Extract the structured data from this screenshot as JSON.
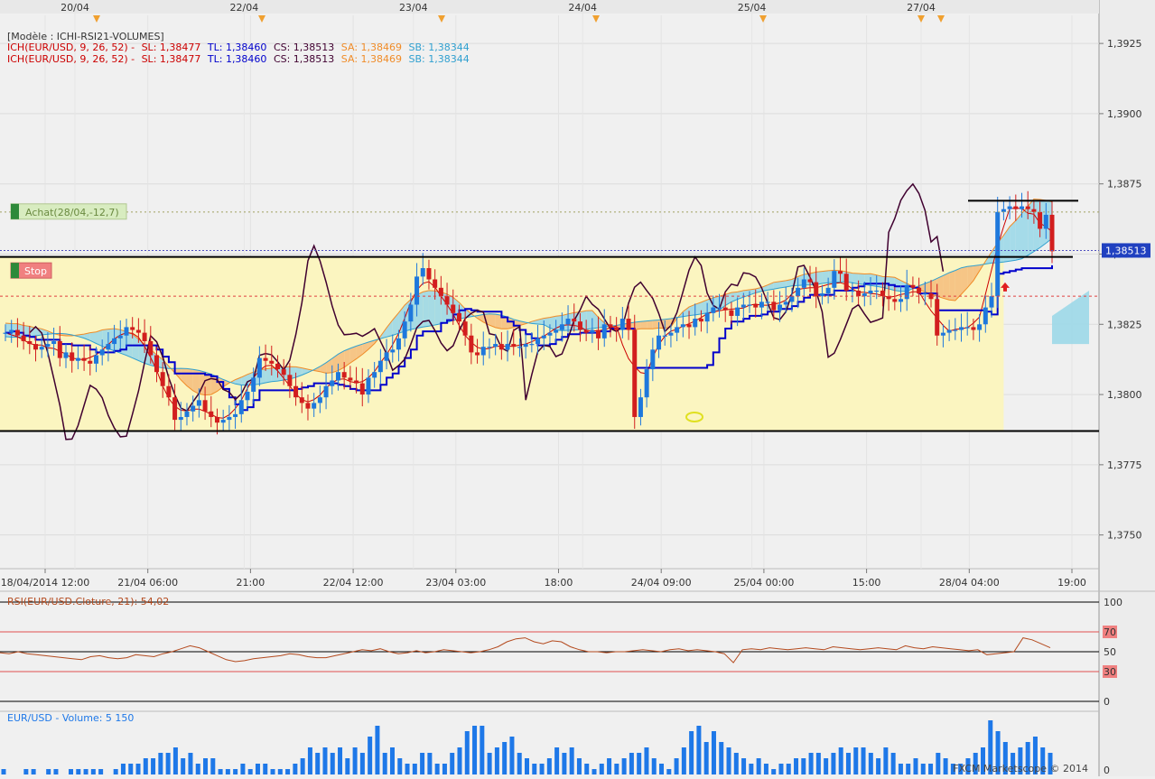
{
  "header": {
    "model_label": "[Modèle : ICHI-RSI21-VOLUMES]",
    "ich_lines": [
      {
        "prefix": "ICH(EUR/USD, 9, 26, 52) -",
        "sl": "SL: 1,38477",
        "tl": "TL: 1,38460",
        "cs": "CS: 1,38513",
        "sa": "SA: 1,38469",
        "sb": "SB: 1,38344"
      },
      {
        "prefix": "ICH(EUR/USD, 9, 26, 52) -",
        "sl": "SL: 1,38477",
        "tl": "TL: 1,38460",
        "cs": "CS: 1,38513",
        "sa": "SA: 1,38469",
        "sb": "SB: 1,38344"
      }
    ]
  },
  "colors": {
    "sl": "#cc0000",
    "tl": "#0000cc",
    "cs": "#400030",
    "sa": "#f08c28",
    "sb": "#30a0d0",
    "up_candle": "#1e78dc",
    "down_candle": "#d21e1e",
    "range_box": "#fbf5c0",
    "cloud_bear": "#f5c080",
    "cloud_bull": "#9cd8e8",
    "volume": "#1e78e8",
    "rsi": "#b44a1e"
  },
  "top_dates": [
    "20/04",
    "22/04",
    "23/04",
    "24/04",
    "25/04",
    "27/04"
  ],
  "annotations": {
    "buy_label": "Achat(28/04,-12,7)",
    "stop_label": "Stop",
    "last_price": "1,38513"
  },
  "watermark": "FXCM Marketscope © 2014",
  "chart_data": [
    {
      "type": "candlestick",
      "title": "EUR/USD",
      "x_tick_labels": [
        "18/04/2014 12:00",
        "21/04 06:00",
        "21:00",
        "22/04 12:00",
        "23/04 03:00",
        "18:00",
        "24/04 09:00",
        "25/04 00:00",
        "15:00",
        "28/04 04:00",
        "19:00"
      ],
      "y_tick_labels": [
        "1,3925",
        "1,3900",
        "1,3875",
        "1,3850",
        "1,3825",
        "1,3800",
        "1,3775",
        "1,3750"
      ],
      "ylim": [
        1.3738,
        1.3935
      ],
      "close": [
        1.3822,
        1.3823,
        1.3821,
        1.3819,
        1.3818,
        1.3816,
        1.3817,
        1.3818,
        1.3819,
        1.3813,
        1.3815,
        1.3812,
        1.3813,
        1.3812,
        1.3811,
        1.3814,
        1.3816,
        1.3818,
        1.382,
        1.3821,
        1.3824,
        1.3823,
        1.3822,
        1.3819,
        1.3814,
        1.3808,
        1.3803,
        1.3799,
        1.3791,
        1.3792,
        1.3794,
        1.3796,
        1.3798,
        1.3794,
        1.3792,
        1.379,
        1.3791,
        1.3792,
        1.3793,
        1.3798,
        1.3801,
        1.3806,
        1.3813,
        1.3812,
        1.3811,
        1.3809,
        1.3807,
        1.3803,
        1.3799,
        1.3797,
        1.3795,
        1.3797,
        1.3799,
        1.3803,
        1.3805,
        1.3808,
        1.3806,
        1.3805,
        1.3804,
        1.38,
        1.3806,
        1.3808,
        1.3812,
        1.3815,
        1.3816,
        1.382,
        1.3826,
        1.3832,
        1.3842,
        1.3845,
        1.3841,
        1.3838,
        1.3835,
        1.3832,
        1.3829,
        1.3826,
        1.3821,
        1.3815,
        1.3814,
        1.3817,
        1.3817,
        1.3818,
        1.3816,
        1.3818,
        1.3817,
        1.3817,
        1.3818,
        1.3818,
        1.382,
        1.3821,
        1.3822,
        1.3823,
        1.3825,
        1.3827,
        1.3826,
        1.3823,
        1.3822,
        1.3823,
        1.382,
        1.3825,
        1.3824,
        1.3823,
        1.3827,
        1.3823,
        1.3792,
        1.3799,
        1.3809,
        1.3816,
        1.3821,
        1.3821,
        1.3822,
        1.3824,
        1.3825,
        1.3824,
        1.3827,
        1.3826,
        1.3829,
        1.3831,
        1.3831,
        1.383,
        1.3828,
        1.3831,
        1.3832,
        1.3832,
        1.3831,
        1.3833,
        1.3833,
        1.383,
        1.3832,
        1.3833,
        1.3835,
        1.3838,
        1.3841,
        1.384,
        1.3835,
        1.3836,
        1.3838,
        1.3844,
        1.3843,
        1.3837,
        1.3837,
        1.3835,
        1.3836,
        1.3837,
        1.3837,
        1.3835,
        1.3834,
        1.3833,
        1.3834,
        1.3839,
        1.3838,
        1.3836,
        1.3836,
        1.3834,
        1.3821,
        1.3822,
        1.3823,
        1.3823,
        1.3824,
        1.3824,
        1.3823,
        1.3825,
        1.3831,
        1.3835,
        1.3865,
        1.3866,
        1.3867,
        1.3866,
        1.3867,
        1.3866,
        1.3865,
        1.3859,
        1.3864,
        1.3851
      ],
      "horizontal_levels": [
        1.3849,
        1.3787,
        1.3869
      ],
      "current_price": 1.38513
    },
    {
      "type": "line",
      "title": "RSI(EUR/USD.Cloture, 21): 54,02",
      "y_tick_labels": [
        "100",
        "70",
        "50",
        "30",
        "0"
      ],
      "levels": [
        100,
        70,
        50,
        30,
        0
      ],
      "value": 54.02,
      "values": [
        49,
        48,
        50,
        48,
        47,
        46,
        45,
        44,
        43,
        42,
        45,
        46,
        44,
        43,
        44,
        47,
        46,
        45,
        48,
        50,
        53,
        56,
        54,
        50,
        46,
        42,
        40,
        41,
        43,
        44,
        45,
        46,
        48,
        47,
        45,
        44,
        44,
        46,
        48,
        50,
        52,
        51,
        53,
        50,
        48,
        49,
        51,
        49,
        50,
        52,
        51,
        50,
        49,
        50,
        52,
        55,
        60,
        63,
        64,
        60,
        58,
        61,
        60,
        55,
        52,
        50,
        50,
        49,
        50,
        50,
        51,
        52,
        51,
        50,
        52,
        53,
        51,
        52,
        51,
        50,
        48,
        39,
        52,
        53,
        52,
        54,
        53,
        52,
        53,
        54,
        53,
        52,
        55,
        54,
        53,
        52,
        53,
        54,
        53,
        52,
        56,
        54,
        53,
        55,
        54,
        53,
        52,
        51,
        52,
        47,
        48,
        49,
        50,
        64,
        62,
        58,
        54
      ]
    },
    {
      "type": "bar",
      "title": "EUR/USD - Volume: 5 150",
      "y_tick_labels": [
        "0"
      ],
      "values": [
        1,
        0,
        0,
        1,
        1,
        0,
        1,
        1,
        0,
        1,
        1,
        1,
        1,
        1,
        0,
        1,
        2,
        2,
        2,
        3,
        3,
        4,
        4,
        5,
        3,
        4,
        2,
        3,
        3,
        1,
        1,
        1,
        2,
        1,
        2,
        2,
        1,
        1,
        1,
        2,
        3,
        5,
        4,
        5,
        4,
        5,
        3,
        5,
        4,
        7,
        9,
        4,
        5,
        3,
        2,
        2,
        4,
        4,
        2,
        2,
        4,
        5,
        8,
        9,
        9,
        4,
        5,
        6,
        7,
        4,
        3,
        2,
        2,
        3,
        5,
        4,
        5,
        3,
        2,
        1,
        2,
        3,
        2,
        3,
        4,
        4,
        5,
        3,
        2,
        1,
        3,
        5,
        8,
        9,
        6,
        8,
        6,
        5,
        4,
        3,
        2,
        3,
        2,
        1,
        2,
        2,
        3,
        3,
        4,
        4,
        3,
        4,
        5,
        4,
        5,
        5,
        4,
        3,
        5,
        4,
        2,
        2,
        3,
        2,
        2,
        4,
        3,
        2,
        2,
        3,
        4,
        5,
        10,
        8,
        6,
        4,
        5,
        6,
        7,
        5,
        4
      ]
    }
  ]
}
